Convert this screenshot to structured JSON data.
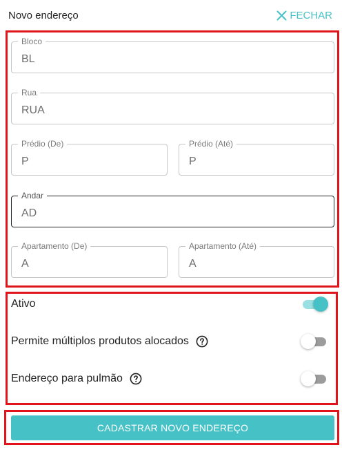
{
  "header": {
    "title": "Novo endereço",
    "close_label": "FECHAR",
    "close_icon": "close-icon"
  },
  "fields": {
    "bloco": {
      "label": "Bloco",
      "value": "BL"
    },
    "rua": {
      "label": "Rua",
      "value": "RUA"
    },
    "predio_de": {
      "label": "Prédio (De)",
      "value": "P"
    },
    "predio_ate": {
      "label": "Prédio (Até)",
      "value": "P"
    },
    "andar": {
      "label": "Andar",
      "value": "AD"
    },
    "apartamento_de": {
      "label": "Apartamento (De)",
      "value": "A"
    },
    "apartamento_ate": {
      "label": "Apartamento (Até)",
      "value": "A"
    }
  },
  "toggles": {
    "ativo": {
      "label": "Ativo",
      "checked": true
    },
    "multiplos": {
      "label": "Permite múltiplos produtos alocados",
      "checked": false,
      "icon": "help-icon"
    },
    "pulmao": {
      "label": "Endereço para pulmão",
      "checked": false,
      "icon": "help-icon"
    }
  },
  "submit": {
    "label": "CADASTRAR NOVO ENDEREÇO"
  },
  "colors": {
    "accent": "#46c1c6",
    "highlight_frame": "#e0141b",
    "toggle_off": "#9c9c9c"
  }
}
